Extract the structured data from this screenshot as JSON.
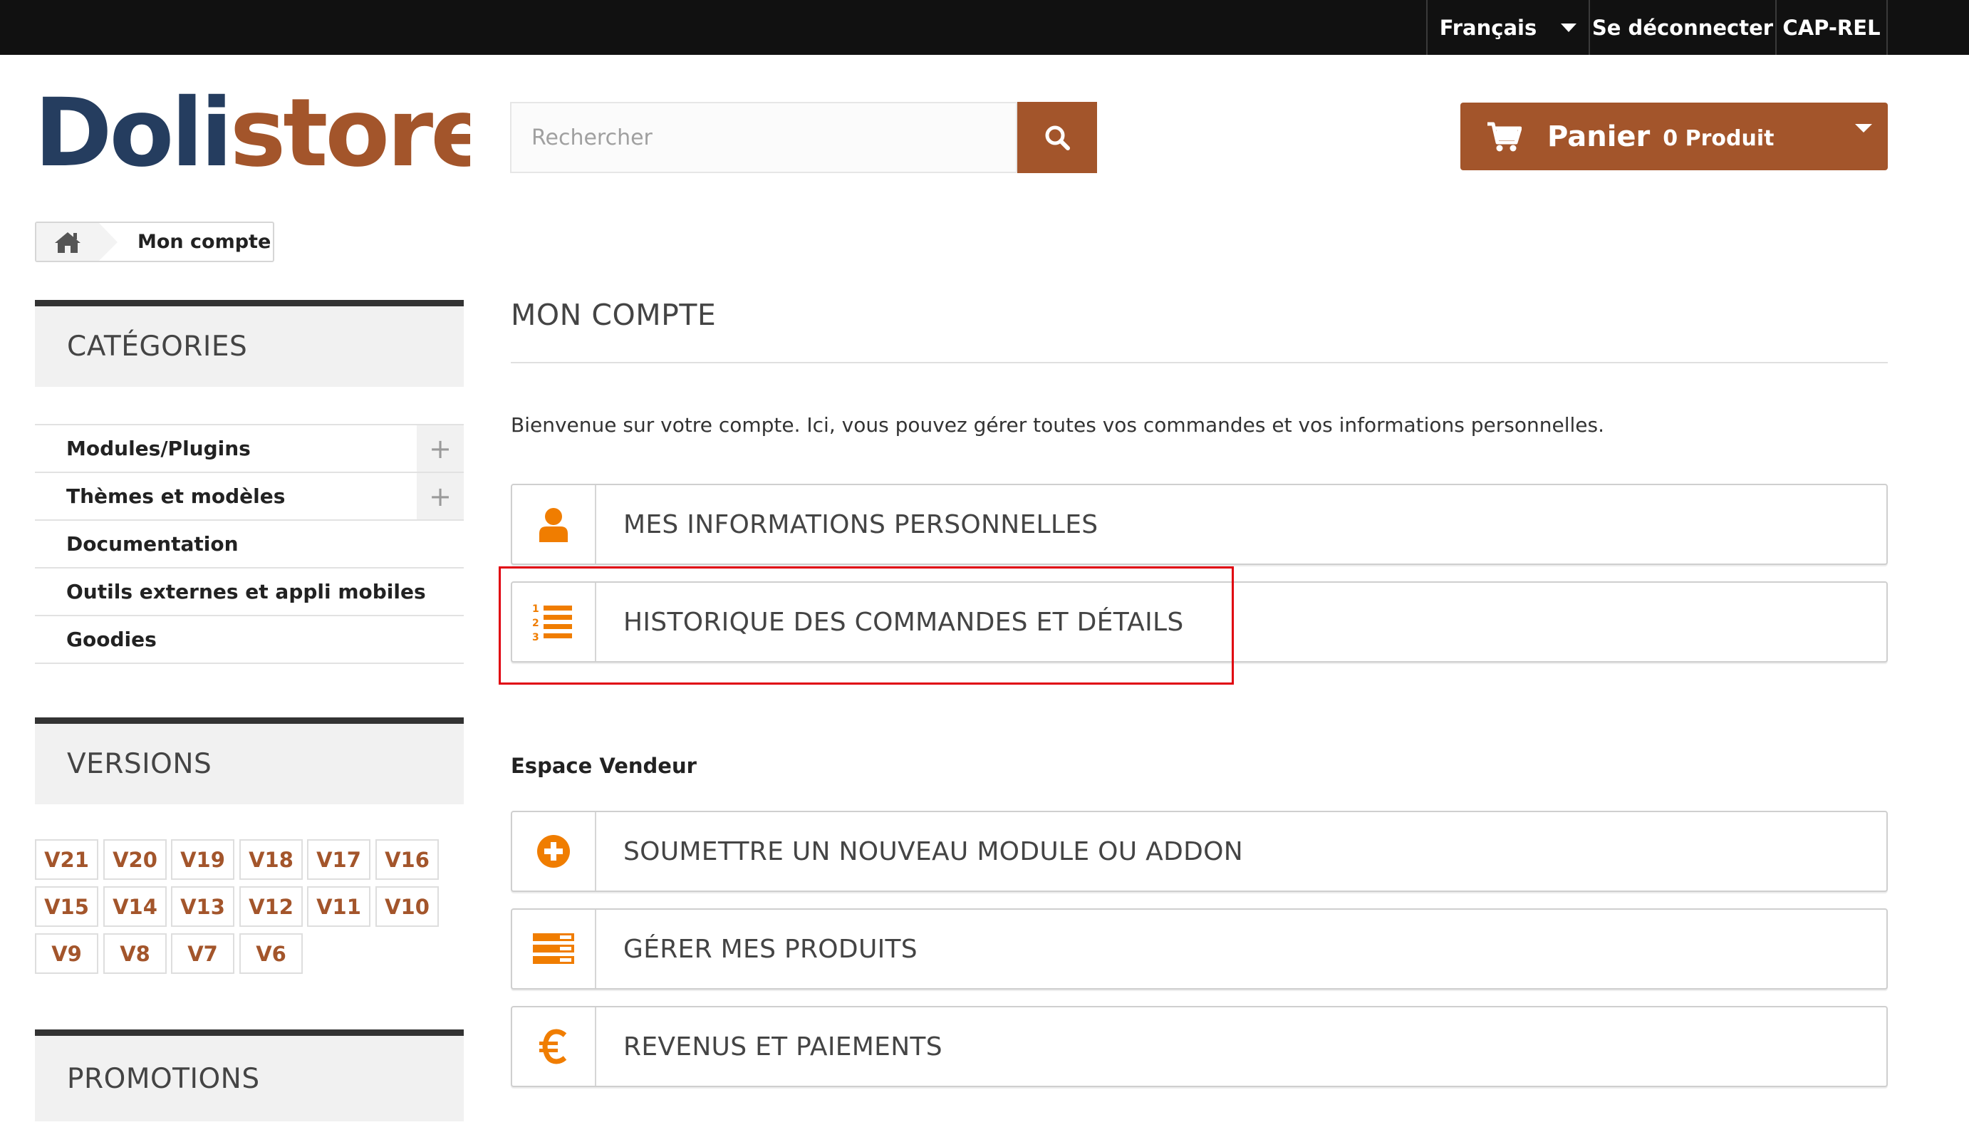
{
  "topbar": {
    "language": "Français",
    "logout": "Se déconnecter",
    "account": "CAP-REL"
  },
  "logo": {
    "text": "Dolistore"
  },
  "search": {
    "placeholder": "Rechercher"
  },
  "cart": {
    "label": "Panier",
    "count": "0 Produit"
  },
  "breadcrumb": {
    "current": "Mon compte"
  },
  "sidebar": {
    "categories_title": "CATÉGORIES",
    "categories": [
      {
        "label": "Modules/Plugins",
        "expandable": true
      },
      {
        "label": "Thèmes et modèles",
        "expandable": true
      },
      {
        "label": "Documentation",
        "expandable": false
      },
      {
        "label": "Outils externes et appli mobiles",
        "expandable": false
      },
      {
        "label": "Goodies",
        "expandable": false
      }
    ],
    "versions_title": "VERSIONS",
    "versions": [
      "V21",
      "V20",
      "V19",
      "V18",
      "V17",
      "V16",
      "V15",
      "V14",
      "V13",
      "V12",
      "V11",
      "V10",
      "V9",
      "V8",
      "V7",
      "V6"
    ],
    "promotions_title": "PROMOTIONS"
  },
  "main": {
    "title": "MON COMPTE",
    "welcome": "Bienvenue sur votre compte. Ici, vous pouvez gérer toutes vos commandes et vos informations personnelles.",
    "links": [
      {
        "label": "MES INFORMATIONS PERSONNELLES",
        "icon": "user-icon"
      },
      {
        "label": "HISTORIQUE DES COMMANDES ET DÉTAILS",
        "icon": "ordered-list-icon"
      }
    ],
    "vendor_section": "Espace Vendeur",
    "vendor_links": [
      {
        "label": "SOUMETTRE UN NOUVEAU MODULE OU ADDON",
        "icon": "plus-circle-icon"
      },
      {
        "label": "GÉRER MES PRODUITS",
        "icon": "product-list-icon"
      },
      {
        "label": "REVENUS ET PAIEMENTS",
        "icon": "euro-icon"
      }
    ]
  },
  "colors": {
    "accent": "#a3552b",
    "icon_orange": "#f07d00",
    "highlight": "#e0000f"
  }
}
